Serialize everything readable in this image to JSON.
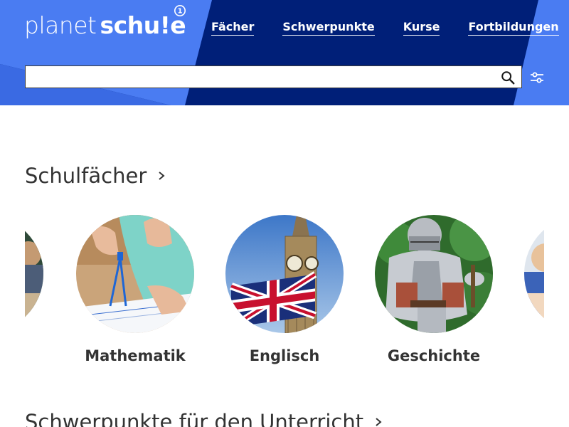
{
  "header": {
    "logo_text_light": "planet",
    "logo_text_bold": "schu!e",
    "nav": [
      {
        "label": "Fächer"
      },
      {
        "label": "Schwerpunkte"
      },
      {
        "label": "Kurse"
      },
      {
        "label": "Fortbildungen"
      }
    ],
    "search": {
      "value": "",
      "placeholder": ""
    },
    "icons": {
      "search": "search-icon",
      "filter": "filter-sliders-icon"
    },
    "colors": {
      "navy": "#001f78",
      "accent_blue": "#4a7cf2"
    }
  },
  "main": {
    "section1_title": "Schulfächer",
    "subjects": [
      {
        "label": "Mathematik"
      },
      {
        "label": "Englisch"
      },
      {
        "label": "Geschichte"
      }
    ],
    "section2_title": "Schwerpunkte für den Unterricht"
  }
}
